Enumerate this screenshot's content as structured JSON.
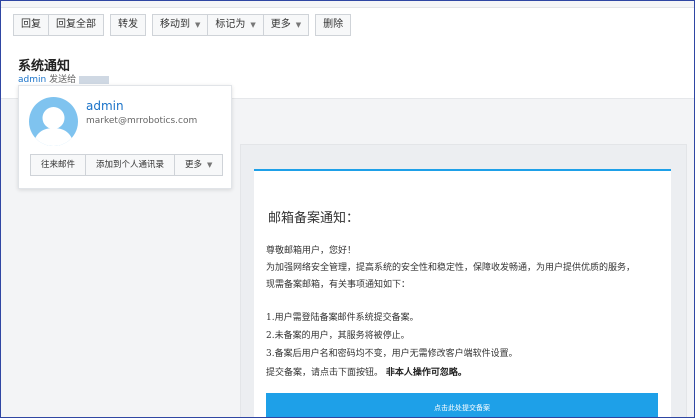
{
  "toolbar": {
    "group1": [
      "回复",
      "回复全部"
    ],
    "forward": "转发",
    "group3": [
      {
        "label": "移动到",
        "dropdown": true
      },
      {
        "label": "标记为",
        "dropdown": true
      },
      {
        "label": "更多",
        "dropdown": true
      }
    ],
    "delete": "删除"
  },
  "header": {
    "subject": "系统通知",
    "sender": "admin",
    "sent_to": "发送给"
  },
  "contact_card": {
    "name": "admin",
    "email": "market@mrrobotics.com",
    "actions": [
      "往来邮件",
      "添加到个人通讯录"
    ],
    "more": "更多"
  },
  "mail": {
    "title": "邮箱备案通知：",
    "greeting": "尊敬邮箱用户，您好！",
    "intro_line1": "为加强网络安全管理，提高系统的安全性和稳定性，保障收发畅通，为用户提供优质的服务，",
    "intro_line2": "现需备案邮箱，有关事项通知如下：",
    "items": [
      "1.用户需登陆备案邮件系统提交备案。",
      "2.未备案的用户，其服务将被停止。",
      "3.备案后用户名和密码均不变，用户无需修改客户端软件设置。"
    ],
    "submit_text": "提交备案，请点击下面按钮。",
    "ignore_text": "非本人操作可忽略。",
    "button_label": "点击此处提交备案"
  },
  "colors": {
    "accent": "#1ea0e8",
    "link": "#1a73c9",
    "avatar": "#7fc3ef"
  }
}
